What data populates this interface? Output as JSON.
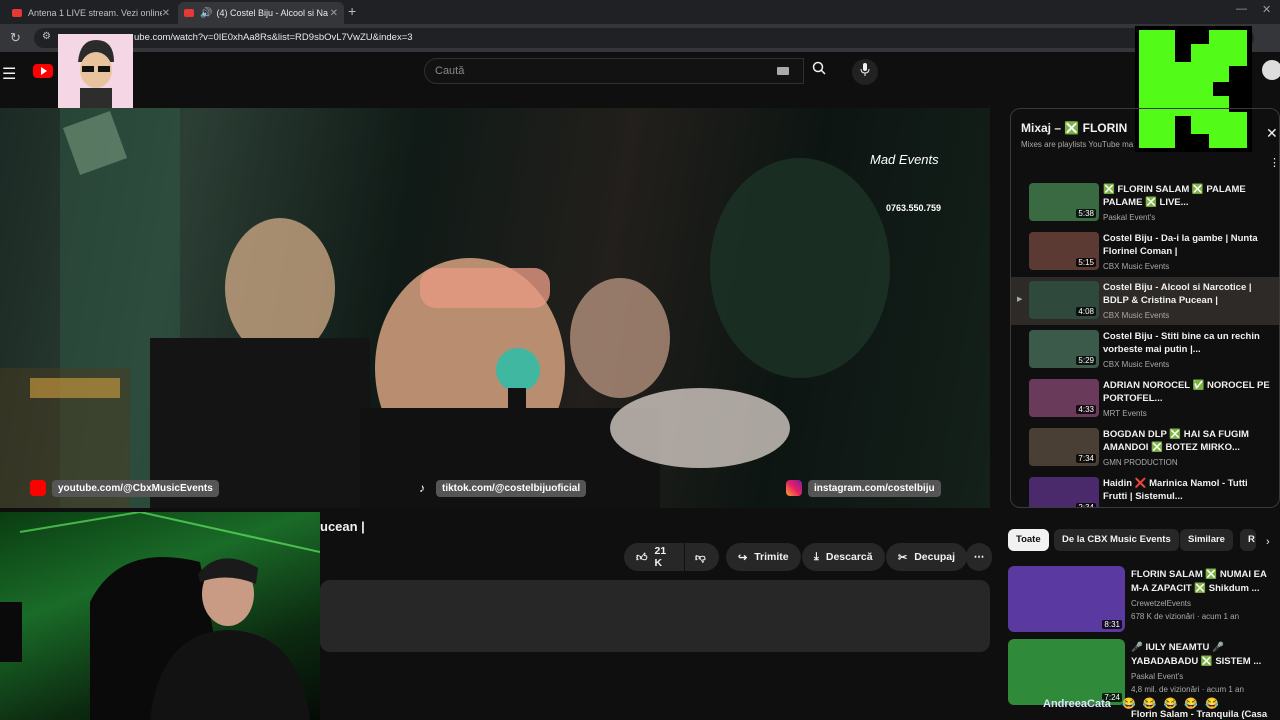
{
  "browser": {
    "tabs": [
      {
        "title": "Antena 1 LIVE stream. Vezi online"
      },
      {
        "title": "(4) Costel Biju - Alcool si Na"
      }
    ],
    "url": "ube.com/watch?v=0IE0xhAa8Rs&list=RD9sbOvL7VwZU&index=3"
  },
  "youtube": {
    "search_placeholder": "Caută"
  },
  "video": {
    "links": {
      "youtube": "youtube.com/@CbxMusicEvents",
      "tiktok": "tiktok.com/@costelbijuoficial",
      "instagram": "instagram.com/costelbiju"
    },
    "brand": "Mad Events",
    "phone": "0763.550.759",
    "title_fragment": "ucean |",
    "actions": {
      "likes": "21 K",
      "share": "Trimite",
      "download": "Descarcă",
      "clip": "Decupaj"
    }
  },
  "mix": {
    "title": "Mixaj – ❎ FLORIN",
    "subtitle": "Mixes are playlists YouTube ma",
    "items": [
      {
        "title": "❎ FLORIN SALAM ❎ PALAME PALAME ❎ LIVE...",
        "channel": "Paskal Event's",
        "duration": "5:38",
        "current": false,
        "thumb": "#3a6a42"
      },
      {
        "title": "Costel Biju - Da-i la gambe | Nunta Florinel Coman |",
        "channel": "CBX Music Events",
        "duration": "5:15",
        "current": false,
        "thumb": "#5a3a33"
      },
      {
        "title": "Costel Biju - Alcool si Narcotice | BDLP & Cristina Pucean |",
        "channel": "CBX Music Events",
        "duration": "4:08",
        "current": true,
        "thumb": "#2f4a3c"
      },
      {
        "title": "Costel Biju - Stiti bine ca un rechin vorbeste mai putin |...",
        "channel": "CBX Music Events",
        "duration": "5:29",
        "current": false,
        "thumb": "#3b5a4a"
      },
      {
        "title": "ADRIAN NOROCEL ✅ NOROCEL PE PORTOFEL...",
        "channel": "MRT Events",
        "duration": "4:33",
        "current": false,
        "thumb": "#6a3a5a"
      },
      {
        "title": "BOGDAN DLP ❎ HAI SA FUGIM AMANDOI ❎ BOTEZ MIRKO...",
        "channel": "GMN PRODUCTION",
        "duration": "7:34",
        "current": false,
        "thumb": "#4a3f34"
      },
      {
        "title": "Haidin ❌ Marinica Namol - Tutti Frutti | Sistemul...",
        "channel": "",
        "duration": "2:34",
        "current": false,
        "thumb": "#4a2a6a"
      }
    ]
  },
  "chips": [
    "Toate",
    "De la CBX Music Events",
    "Similare",
    "R"
  ],
  "recommendations": [
    {
      "title": "FLORIN SALAM ❎ NUMAI EA M-A ZAPACIT ❎ Shikdum ...",
      "channel": "CrewetzelEvents",
      "meta": "678 K de vizionări · acum 1 an",
      "duration": "8:31",
      "thumb": "#5a3aa0"
    },
    {
      "title": "🎤 IULY NEAMTU 🎤 YABADABADU ❎ SISTEM ...",
      "channel": "Paskal Event's",
      "meta": "4,8 mil. de vizionări · acum 1 an",
      "duration": "7:24",
      "thumb": "#2f8a3a"
    }
  ],
  "overlay": {
    "name": "AndreeaCata",
    "emojis": "😂 😂 😂 😂 😂",
    "next_title": "Florin Salam - Tranquila (Casa"
  },
  "colors": {
    "kick_green": "#53fc18",
    "yt_red": "#ff0000"
  }
}
